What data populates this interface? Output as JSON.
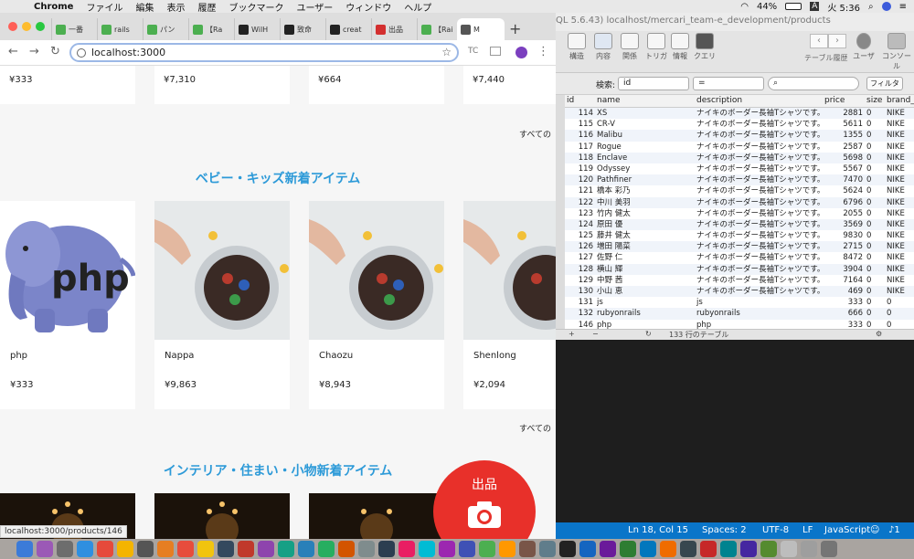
{
  "menubar": {
    "app": "Chrome",
    "items": [
      "ファイル",
      "編集",
      "表示",
      "履歴",
      "ブックマーク",
      "ユーザー",
      "ウィンドウ",
      "ヘルプ"
    ],
    "battery": "44%",
    "input_mode": "A",
    "clock": "火 5:36"
  },
  "chrome": {
    "tabs": [
      {
        "label": "一番",
        "color": "#4caf50"
      },
      {
        "label": "rails",
        "color": "#4caf50"
      },
      {
        "label": "パン",
        "color": "#4caf50"
      },
      {
        "label": "【Ra",
        "color": "#4caf50"
      },
      {
        "label": "WilH",
        "color": "#222"
      },
      {
        "label": "致命",
        "color": "#222"
      },
      {
        "label": "creat",
        "color": "#222"
      },
      {
        "label": "出品",
        "color": "#d32f2f"
      },
      {
        "label": "【Rai",
        "color": "#4caf50"
      },
      {
        "label": "M",
        "color": "#555"
      }
    ],
    "url": "localhost:3000",
    "status_url": "localhost:3000/products/146"
  },
  "page": {
    "top_prices": [
      "¥333",
      "¥7,310",
      "¥664",
      "¥7,440"
    ],
    "see_all": "すべての",
    "section_kids": "ベビー・キッズ新着アイテム",
    "section_interior": "インテリア・住まい・小物新着アイテム",
    "kids_items": [
      {
        "name": "php",
        "price": "¥333"
      },
      {
        "name": "Nappa",
        "price": "¥9,863"
      },
      {
        "name": "Chaozu",
        "price": "¥8,943"
      },
      {
        "name": "Shenlong",
        "price": "¥2,094"
      }
    ],
    "php_logo_text": "php",
    "fab_label": "出品"
  },
  "sequel": {
    "title": "QL 5.6.43) localhost/mercari_team-e_development/products",
    "toolbar": [
      "構造",
      "内容",
      "関係",
      "トリガ",
      "情報",
      "クエリ"
    ],
    "toolbar_right": [
      "テーブル履歴",
      "ユーザ",
      "コンソール"
    ],
    "filter_label": "検索:",
    "filter_field": "id",
    "filter_op": "=",
    "filter_button": "フィルタ",
    "columns": [
      "id",
      "name",
      "description",
      "price",
      "size",
      "brand_na"
    ],
    "rows": [
      [
        "114",
        "XS",
        "ナイキのボーダー長袖Tシャツです。",
        "2881",
        "0",
        "NIKE"
      ],
      [
        "115",
        "CR-V",
        "ナイキのボーダー長袖Tシャツです。",
        "5611",
        "0",
        "NIKE"
      ],
      [
        "116",
        "Malibu",
        "ナイキのボーダー長袖Tシャツです。",
        "1355",
        "0",
        "NIKE"
      ],
      [
        "117",
        "Rogue",
        "ナイキのボーダー長袖Tシャツです。",
        "2587",
        "0",
        "NIKE"
      ],
      [
        "118",
        "Enclave",
        "ナイキのボーダー長袖Tシャツです。",
        "5698",
        "0",
        "NIKE"
      ],
      [
        "119",
        "Odyssey",
        "ナイキのボーダー長袖Tシャツです。",
        "5567",
        "0",
        "NIKE"
      ],
      [
        "120",
        "Pathfiner",
        "ナイキのボーダー長袖Tシャツです。",
        "7470",
        "0",
        "NIKE"
      ],
      [
        "121",
        "橋本 彩乃",
        "ナイキのボーダー長袖Tシャツです。",
        "5624",
        "0",
        "NIKE"
      ],
      [
        "122",
        "中川 美羽",
        "ナイキのボーダー長袖Tシャツです。",
        "6796",
        "0",
        "NIKE"
      ],
      [
        "123",
        "竹内 健太",
        "ナイキのボーダー長袖Tシャツです。",
        "2055",
        "0",
        "NIKE"
      ],
      [
        "124",
        "原田 優",
        "ナイキのボーダー長袖Tシャツです。",
        "3569",
        "0",
        "NIKE"
      ],
      [
        "125",
        "藤井 健太",
        "ナイキのボーダー長袖Tシャツです。",
        "9830",
        "0",
        "NIKE"
      ],
      [
        "126",
        "増田 陽菜",
        "ナイキのボーダー長袖Tシャツです。",
        "2715",
        "0",
        "NIKE"
      ],
      [
        "127",
        "佐野 仁",
        "ナイキのボーダー長袖Tシャツです。",
        "8472",
        "0",
        "NIKE"
      ],
      [
        "128",
        "横山 輝",
        "ナイキのボーダー長袖Tシャツです。",
        "3904",
        "0",
        "NIKE"
      ],
      [
        "129",
        "中野 茜",
        "ナイキのボーダー長袖Tシャツです。",
        "7164",
        "0",
        "NIKE"
      ],
      [
        "130",
        "小山 恵",
        "ナイキのボーダー長袖Tシャツです。",
        "469",
        "0",
        "NIKE"
      ],
      [
        "131",
        "js",
        "js",
        "333",
        "0",
        "0"
      ],
      [
        "132",
        "rubyonrails",
        "rubyonrails",
        "666",
        "0",
        "0"
      ],
      [
        "146",
        "php",
        "php",
        "333",
        "0",
        "0"
      ]
    ],
    "row_count": "133 行のテーブル"
  },
  "vscode_status": {
    "position": "Ln 18, Col 15",
    "spaces": "Spaces: 2",
    "encoding": "UTF-8",
    "eol": "LF",
    "language": "JavaScript"
  },
  "dock_colors": [
    "#3c7bd8",
    "#9b59b6",
    "#6d6d6d",
    "#2f8fe0",
    "#e64a3b",
    "#f4b400",
    "#555",
    "#e67e22",
    "#e74c3c",
    "#f1c40f",
    "#34495e",
    "#c0392b",
    "#8e44ad",
    "#16a085",
    "#2980b9",
    "#27ae60",
    "#d35400",
    "#7f8c8d",
    "#2c3e50",
    "#e91e63",
    "#00bcd4",
    "#9c27b0",
    "#3f51b5",
    "#4caf50",
    "#ff9800",
    "#795548",
    "#607d8b",
    "#222",
    "#1565c0",
    "#6a1b9a",
    "#2e7d32",
    "#0277bd",
    "#ef6c00",
    "#37474f",
    "#c62828",
    "#00838f",
    "#4527a0",
    "#558b2f",
    "#bdbdbd",
    "#9e9e9e",
    "#757575"
  ]
}
